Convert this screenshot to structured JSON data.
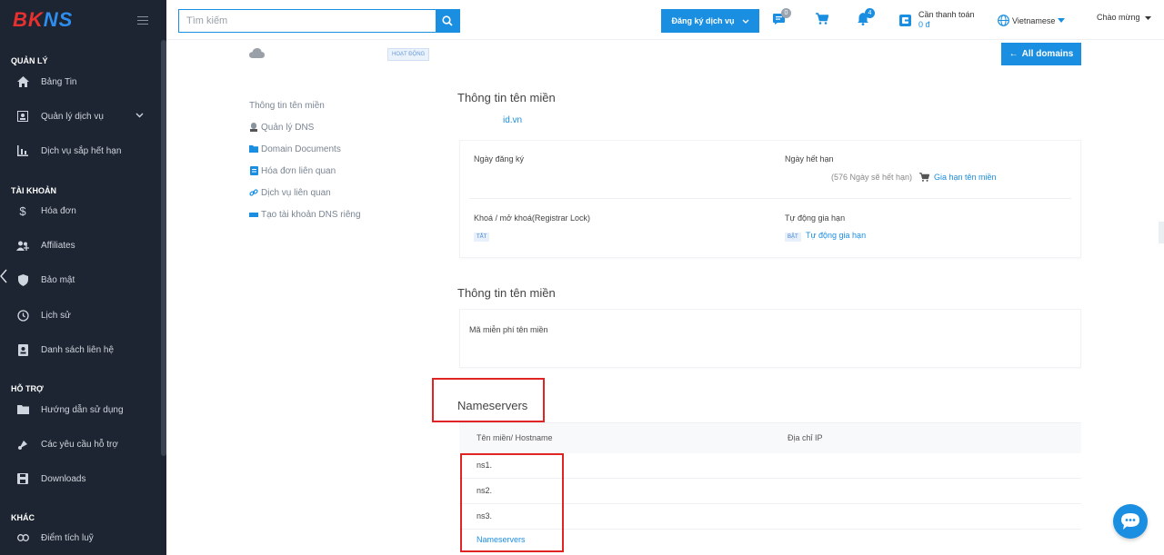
{
  "brand": {
    "logo_left": "BK",
    "logo_right": "NS"
  },
  "sidebar": {
    "sections": [
      {
        "title": "QUẢN LÝ"
      },
      {
        "title": "TÀI KHOẢN"
      },
      {
        "title": "HỖ TRỢ"
      },
      {
        "title": "KHÁC"
      }
    ],
    "items": [
      {
        "label": "Bảng Tin",
        "icon": "home-icon"
      },
      {
        "label": "Quản lý dịch vụ",
        "icon": "service-icon"
      },
      {
        "label": "Dịch vụ sắp hết hạn",
        "icon": "bar-chart-icon"
      },
      {
        "label": "Hóa đơn",
        "icon": "dollar-icon"
      },
      {
        "label": "Affiliates",
        "icon": "users-icon"
      },
      {
        "label": "Bảo mật",
        "icon": "shield-icon"
      },
      {
        "label": "Lịch sử",
        "icon": "history-icon"
      },
      {
        "label": "Danh sách liên hệ",
        "icon": "contacts-icon"
      },
      {
        "label": "Hướng dẫn sử dụng",
        "icon": "folder-icon"
      },
      {
        "label": "Các yêu cầu hỗ trợ",
        "icon": "support-icon"
      },
      {
        "label": "Downloads",
        "icon": "download-icon"
      },
      {
        "label": "Điểm tích luỹ",
        "icon": "link-icon"
      }
    ]
  },
  "header": {
    "search_placeholder": "Tìm kiếm",
    "register_label": "Đăng ký dịch vụ",
    "ticket_badge": "0",
    "notify_badge": "4",
    "payment_label": "Cần thanh toán",
    "payment_amount": "0 đ",
    "language": "Vietnamese",
    "greeting": "Chào mừng"
  },
  "main": {
    "status_tag": "HOẠT ĐỘNG",
    "all_domains_label": "All domains",
    "menu": [
      {
        "label": "Thông tin tên miền",
        "icon": ""
      },
      {
        "label": "Quản lý DNS",
        "icon": "dns-icon"
      },
      {
        "label": "Domain Documents",
        "icon": "folder-icon"
      },
      {
        "label": "Hóa đơn liên quan",
        "icon": "invoice-icon"
      },
      {
        "label": "Dịch vụ liên quan",
        "icon": "link-icon"
      },
      {
        "label": "Tạo tài khoản DNS riêng",
        "icon": "dns-account-icon"
      }
    ],
    "info_title": "Thông tin tên miền",
    "domain": "id.vn",
    "reg_date_label": "Ngày đăng ký",
    "expiry_label": "Ngày hết hạn",
    "expiry_remaining": "(576 Ngày sẽ hết hạn)",
    "renew_link": "Gia hạn tên miền",
    "lock_label": "Khoá / mở khoá(Registrar Lock)",
    "lock_tag": "TẮT",
    "auto_renew_label": "Tự động gia hạn",
    "auto_renew_tag": "BẬT",
    "auto_renew_link": "Tự động gia hạn",
    "info_title_2": "Thông tin tên miền",
    "free_code_label": "Mã miễn phí tên miền",
    "ns_title": "Nameservers",
    "ns_col_host": "Tên miền/ Hostname",
    "ns_col_ip": "Địa chỉ IP",
    "ns_rows": [
      "ns1.",
      "ns2.",
      "ns3."
    ],
    "ns_link": "Nameservers"
  },
  "colors": {
    "primary": "#1a8ee1",
    "sidebar_bg": "#1e2532",
    "highlight": "#e02424"
  }
}
